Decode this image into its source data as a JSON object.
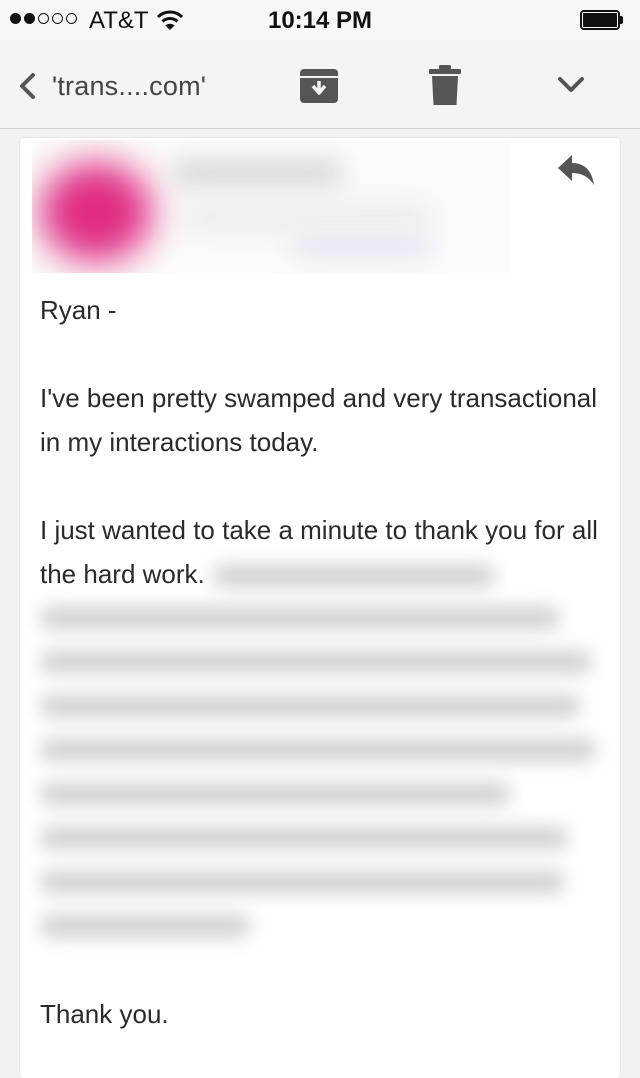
{
  "status_bar": {
    "carrier": "AT&T",
    "time": "10:14 PM",
    "signal_bars_filled": 2,
    "signal_bars_total": 5,
    "battery_level": 0.95,
    "icons": [
      "signal-dots-icon",
      "wifi-icon",
      "battery-icon"
    ]
  },
  "toolbar": {
    "sender_short": "'trans....com'",
    "icons": [
      "chevron-left-icon",
      "archive-icon",
      "trash-icon",
      "chevron-down-icon"
    ]
  },
  "message": {
    "reply_icon": "reply-icon",
    "greeting": "Ryan -",
    "paragraph1": "I've been pretty swamped and very transactional in my interactions today.",
    "paragraph2_visible": "I just wanted to take a minute to thank you for all the hard work.",
    "closing": "Thank you."
  },
  "colors": {
    "avatar": "#e02c82",
    "toolbar_icon": "#555555",
    "text": "#2a2a2a"
  }
}
